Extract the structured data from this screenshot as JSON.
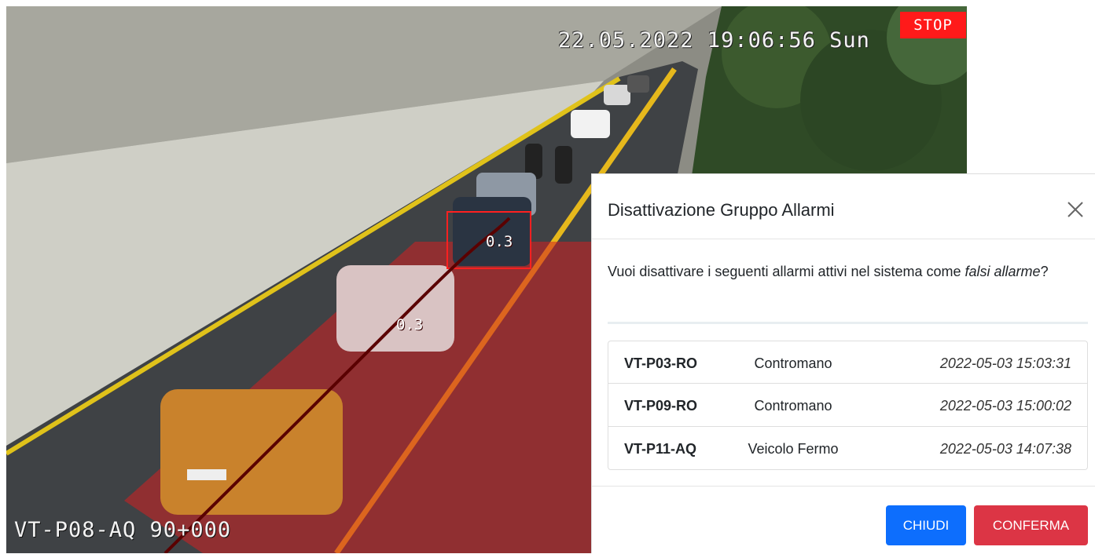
{
  "camera": {
    "timestamp": "22.05.2022 19:06:56 Sun",
    "stop_badge": "STOP",
    "label": "VT-P08-AQ 90+000",
    "detections": [
      {
        "score": "0.3"
      },
      {
        "score": "0.3"
      }
    ]
  },
  "modal": {
    "title": "Disattivazione Gruppo Allarmi",
    "close_icon": "close-icon",
    "message_prefix": "Vuoi disattivare i seguenti allarmi attivi nel sistema come ",
    "message_emphasis": "falsi allarme",
    "message_suffix": "?",
    "alarms": [
      {
        "code": "VT-P03-RO",
        "type": "Contromano",
        "time": "2022-05-03 15:03:31"
      },
      {
        "code": "VT-P09-RO",
        "type": "Contromano",
        "time": "2022-05-03 15:00:02"
      },
      {
        "code": "VT-P11-AQ",
        "type": "Veicolo Fermo",
        "time": "2022-05-03 14:07:38"
      }
    ],
    "buttons": {
      "close": "CHIUDI",
      "confirm": "CONFERMA"
    }
  },
  "colors": {
    "primary": "#0d6efd",
    "danger": "#dc3545",
    "stop_badge": "#ff1a1a",
    "zone_overlay": "#d42020"
  }
}
